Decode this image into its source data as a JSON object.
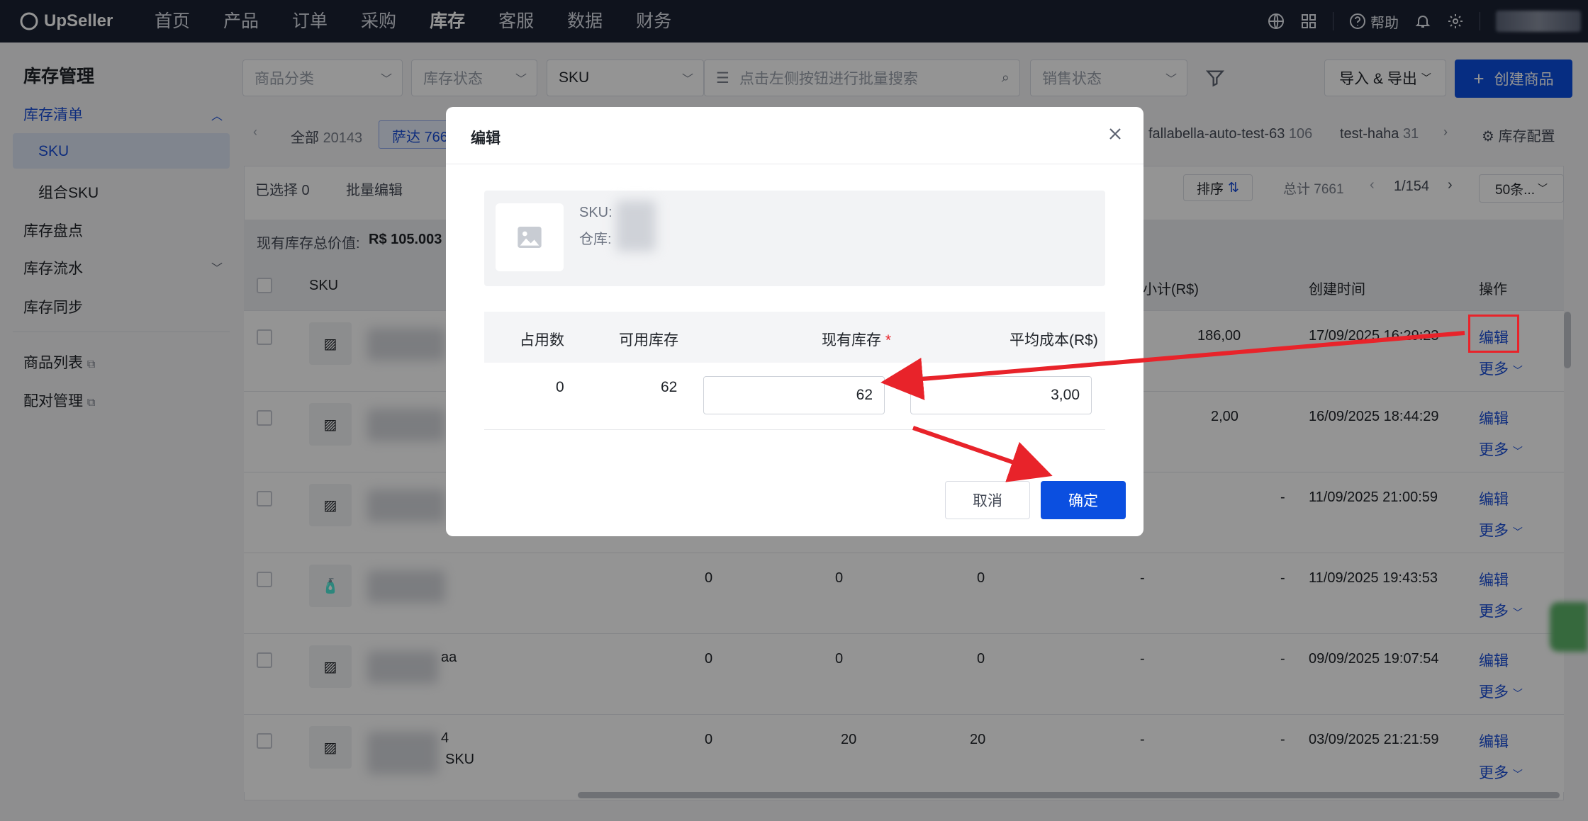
{
  "app": {
    "name": "UpSeller"
  },
  "nav": {
    "items": [
      "首页",
      "产品",
      "订单",
      "采购",
      "库存",
      "客服",
      "数据",
      "财务"
    ],
    "active": "库存",
    "help": "帮助"
  },
  "sidebar": {
    "title": "库存管理",
    "inventory_list": "库存清单",
    "sku": "SKU",
    "combo_sku": "组合SKU",
    "stocktake": "库存盘点",
    "flow": "库存流水",
    "sync": "库存同步",
    "product_list": "商品列表",
    "pairing": "配对管理"
  },
  "filters": {
    "category": "商品分类",
    "stock_status": "库存状态",
    "sku_field": "SKU",
    "search_placeholder": "点击左侧按钮进行批量搜索",
    "sale_status": "销售状态",
    "import_export": "导入 & 导出",
    "create": "创建商品"
  },
  "tabs": {
    "all": "全部",
    "all_count": "20143",
    "sada": "萨达",
    "sada_count": "766",
    "t1": "fallabella-auto-test-63",
    "t1_count": "106",
    "t2": "test-haha",
    "t2_count": "31",
    "config": "库存配置"
  },
  "toolbar": {
    "selected": "已选择 0",
    "batch_edit": "批量编辑",
    "sort": "排序",
    "total": "总计 7661",
    "page": "1/154",
    "page_size": "50条..."
  },
  "summary": {
    "label": "现有库存总价值:",
    "value": "R$ 105.003"
  },
  "table": {
    "headers": {
      "sku": "SKU",
      "subtotal": "小计(R$)",
      "created": "创建时间",
      "actions": "操作"
    },
    "edit_label": "编辑",
    "more_label": "更多",
    "rows": [
      {
        "subtotal": "186,00",
        "created": "17/09/2025 16:29:23",
        "c1": "",
        "c2": "",
        "c3": "",
        "c4": "",
        "c5": "",
        "extra": ""
      },
      {
        "subtotal": "2,00",
        "created": "16/09/2025 18:44:29",
        "c1": "",
        "c2": "",
        "c3": "",
        "c4": "",
        "c5": "",
        "extra": ""
      },
      {
        "subtotal": "-",
        "created": "11/09/2025 21:00:59",
        "c1": "",
        "c2": "",
        "c3": "",
        "c4": "",
        "c5": "",
        "extra": ""
      },
      {
        "subtotal": "-",
        "created": "11/09/2025 19:43:53",
        "c1": "0",
        "c2": "0",
        "c3": "0",
        "c4": "-",
        "c5": "",
        "extra": ""
      },
      {
        "subtotal": "-",
        "created": "09/09/2025 19:07:54",
        "c1": "0",
        "c2": "0",
        "c3": "0",
        "c4": "-",
        "c5": "",
        "extra": "aa"
      },
      {
        "subtotal": "-",
        "created": "03/09/2025 21:21:59",
        "c1": "0",
        "c2": "20",
        "c3": "20",
        "c4": "-",
        "c5": "",
        "extra": "4"
      }
    ],
    "row6_sub": "SKU"
  },
  "modal": {
    "title": "编辑",
    "sku_label": "SKU:",
    "warehouse_label": "仓库:",
    "col_occupied": "占用数",
    "col_available": "可用库存",
    "col_current": "现有库存",
    "col_avg_cost": "平均成本(R$)",
    "occupied": "0",
    "available": "62",
    "current_value": "62",
    "avg_cost_value": "3,00",
    "cancel": "取消",
    "confirm": "确定"
  },
  "colors": {
    "accent": "#0b4fe0",
    "annotation": "#e8232a",
    "nav_bg": "#1b2233"
  }
}
